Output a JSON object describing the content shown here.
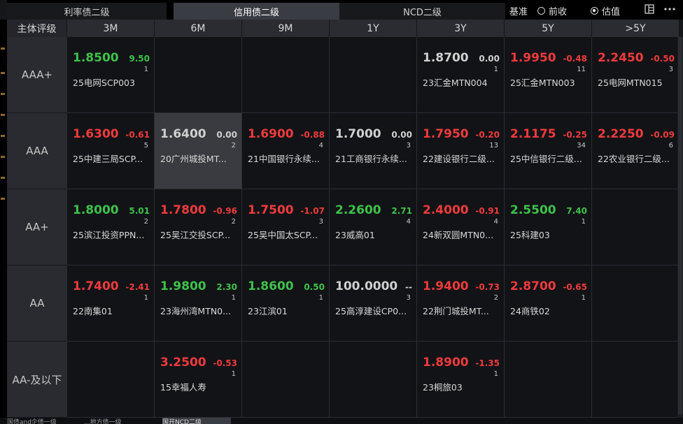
{
  "tabs": [
    {
      "label": "利率债二级",
      "active": false
    },
    {
      "label": "信用债二级",
      "active": true
    },
    {
      "label": "NCD二级",
      "active": false
    }
  ],
  "basis": {
    "label": "基准",
    "options": [
      {
        "label": "前收",
        "selected": false
      },
      {
        "label": "估值",
        "selected": true
      }
    ]
  },
  "icons": [
    "layout-icon",
    "more-icon"
  ],
  "grid": {
    "corner": "主体评级",
    "columns": [
      "3M",
      "6M",
      "9M",
      "1Y",
      "3Y",
      "5Y",
      ">5Y"
    ],
    "rows": [
      {
        "rating": "AAA+",
        "cells": [
          {
            "yield": "1.8500",
            "change": "9.50",
            "count": "1",
            "name": "25电网SCP003",
            "color": "green"
          },
          null,
          null,
          null,
          {
            "yield": "1.8700",
            "change": "0.00",
            "count": "1",
            "name": "23汇金MTN004",
            "color": "white"
          },
          {
            "yield": "1.9950",
            "change": "-0.48",
            "count": "11",
            "name": "25汇金MTN003",
            "color": "red"
          },
          {
            "yield": "2.2450",
            "change": "-0.50",
            "count": "3",
            "name": "25电网MTN015",
            "color": "red"
          }
        ]
      },
      {
        "rating": "AAA",
        "cells": [
          {
            "yield": "1.6300",
            "change": "-0.61",
            "count": "5",
            "name": "25中建三局SCP...",
            "color": "red"
          },
          {
            "yield": "1.6400",
            "change": "0.00",
            "count": "2",
            "name": "20广州城投MT...",
            "color": "white",
            "highlight": true
          },
          {
            "yield": "1.6900",
            "change": "-0.88",
            "count": "4",
            "name": "21中国银行永续...",
            "color": "red"
          },
          {
            "yield": "1.7000",
            "change": "0.00",
            "count": "3",
            "name": "21工商银行永续...",
            "color": "white"
          },
          {
            "yield": "1.7950",
            "change": "-0.20",
            "count": "13",
            "name": "22建设银行二级...",
            "color": "red"
          },
          {
            "yield": "2.1175",
            "change": "-0.25",
            "count": "34",
            "name": "25中信银行二级...",
            "color": "red"
          },
          {
            "yield": "2.2250",
            "change": "-0.09",
            "count": "6",
            "name": "22农业银行二级...",
            "color": "red"
          }
        ]
      },
      {
        "rating": "AA+",
        "cells": [
          {
            "yield": "1.8000",
            "change": "5.01",
            "count": "2",
            "name": "25滨江投资PPN...",
            "color": "green"
          },
          {
            "yield": "1.7800",
            "change": "-0.96",
            "count": "2",
            "name": "25吴江交投SCP...",
            "color": "red"
          },
          {
            "yield": "1.7500",
            "change": "-1.07",
            "count": "3",
            "name": "25吴中国太SCP...",
            "color": "red"
          },
          {
            "yield": "2.2600",
            "change": "2.71",
            "count": "4",
            "name": "23威高01",
            "color": "green"
          },
          {
            "yield": "2.4000",
            "change": "-0.91",
            "count": "4",
            "name": "24新双圆MTN0...",
            "color": "red"
          },
          {
            "yield": "2.5500",
            "change": "7.40",
            "count": "1",
            "name": "25科建03",
            "color": "green"
          },
          null
        ]
      },
      {
        "rating": "AA",
        "cells": [
          {
            "yield": "1.7400",
            "change": "-2.41",
            "count": "1",
            "name": "22南集01",
            "color": "red"
          },
          {
            "yield": "1.9800",
            "change": "2.30",
            "count": "1",
            "name": "23海州湾MTN0...",
            "color": "green"
          },
          {
            "yield": "1.8600",
            "change": "0.50",
            "count": "1",
            "name": "23江滨01",
            "color": "green"
          },
          {
            "yield": "100.0000",
            "change": "--",
            "count": "3",
            "name": "25高淳建设CP0...",
            "color": "white"
          },
          {
            "yield": "1.9400",
            "change": "-0.73",
            "count": "2",
            "name": "22荆门城投MT...",
            "color": "red"
          },
          {
            "yield": "2.8700",
            "change": "-0.65",
            "count": "1",
            "name": "24商铁02",
            "color": "red"
          },
          null
        ]
      },
      {
        "rating": "AA-及以下",
        "cells": [
          null,
          {
            "yield": "3.2500",
            "change": "-0.53",
            "count": "1",
            "name": "15幸福人寿",
            "color": "red"
          },
          null,
          null,
          {
            "yield": "1.8900",
            "change": "-1.35",
            "count": "1",
            "name": "23桐旅03",
            "color": "red"
          },
          null,
          null
        ]
      }
    ]
  },
  "bottom_tabs": [
    "国债and企债一级",
    "...地方债一级",
    "国开NCD二级"
  ]
}
